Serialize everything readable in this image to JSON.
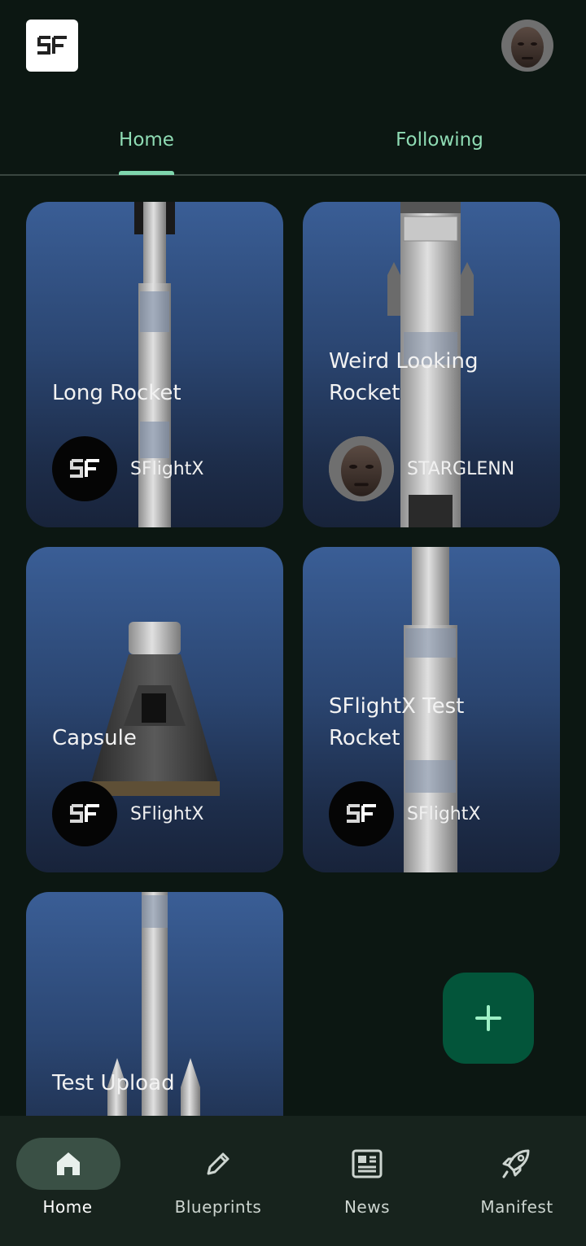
{
  "header": {
    "logo_icon": "sf-logo-icon",
    "avatar_icon": "user-avatar-icon"
  },
  "tabs": [
    {
      "label": "Home",
      "active": true
    },
    {
      "label": "Following",
      "active": false
    }
  ],
  "cards": [
    {
      "title": "Long Rocket",
      "author": "SFlightX",
      "art": "long-rocket"
    },
    {
      "title": "Weird Looking Rocket",
      "author": "STARGLENN",
      "art": "weird-rocket"
    },
    {
      "title": "Capsule",
      "author": "SFlightX",
      "art": "capsule"
    },
    {
      "title": "SFlightX Test Rocket",
      "author": "SFlightX",
      "art": "test-rocket"
    },
    {
      "title": "Test Upload",
      "author": "",
      "art": "test-upload"
    }
  ],
  "fab": {
    "icon": "plus-icon"
  },
  "bottom_nav": [
    {
      "label": "Home",
      "icon": "home-icon",
      "active": true
    },
    {
      "label": "Blueprints",
      "icon": "pencil-icon",
      "active": false
    },
    {
      "label": "News",
      "icon": "news-icon",
      "active": false
    },
    {
      "label": "Manifest",
      "icon": "rocket-icon",
      "active": false
    }
  ],
  "colors": {
    "background": "#0c1712",
    "accent": "#7fd6ad",
    "fab": "#03553a",
    "nav_bar": "#17231d",
    "card_gradient_top": "#3a5e96"
  }
}
